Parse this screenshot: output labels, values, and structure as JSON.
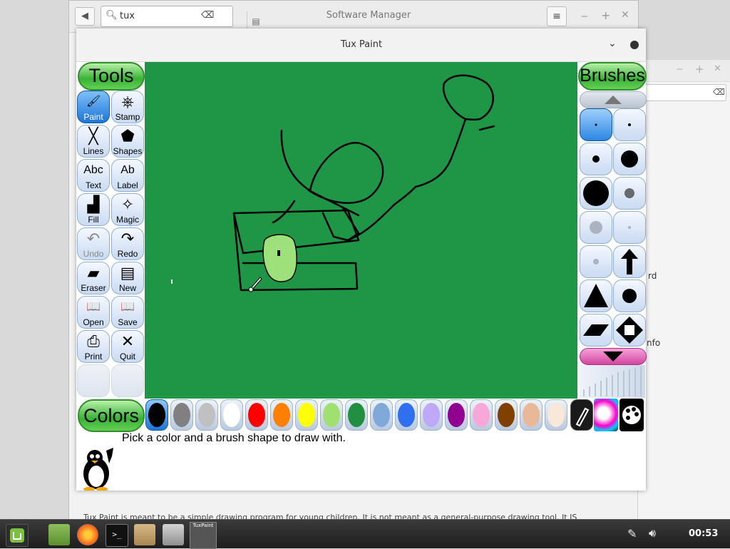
{
  "software_manager": {
    "title": "Software Manager",
    "search_value": "tux",
    "back_icon": "arrow-left-icon",
    "clear_icon": "clear-icon",
    "body_text": "Tux Paint is meant to be a simple drawing program for young children. It is not meant as a general-purpose drawing tool. It IS",
    "right_pane": {
      "word1": "rd",
      "word2": "nfo"
    }
  },
  "tuxpaint": {
    "window_title": "Tux Paint",
    "tools_title": "Tools",
    "brushes_title": "Brushes",
    "colors_title": "Colors",
    "tools": [
      {
        "label": "Paint",
        "icon": "paintbrush-icon",
        "glyph": "🖌",
        "state": "active"
      },
      {
        "label": "Stamp",
        "icon": "stamp-icon",
        "glyph": "⎈",
        "state": "normal"
      },
      {
        "label": "Lines",
        "icon": "lines-icon",
        "glyph": "╳",
        "state": "normal"
      },
      {
        "label": "Shapes",
        "icon": "pentagon-icon",
        "glyph": "⬟",
        "state": "normal"
      },
      {
        "label": "Text",
        "icon": "text-icon",
        "glyph": "Abc",
        "state": "normal"
      },
      {
        "label": "Label",
        "icon": "label-icon",
        "glyph": "Ab",
        "state": "normal"
      },
      {
        "label": "Fill",
        "icon": "bucket-icon",
        "glyph": "▟",
        "state": "normal"
      },
      {
        "label": "Magic",
        "icon": "magic-wand-icon",
        "glyph": "✧",
        "state": "normal"
      },
      {
        "label": "Undo",
        "icon": "undo-icon",
        "glyph": "↶",
        "state": "disabled"
      },
      {
        "label": "Redo",
        "icon": "redo-icon",
        "glyph": "↷",
        "state": "normal"
      },
      {
        "label": "Eraser",
        "icon": "eraser-icon",
        "glyph": "▰",
        "state": "normal"
      },
      {
        "label": "New",
        "icon": "new-document-icon",
        "glyph": "▤",
        "state": "normal"
      },
      {
        "label": "Open",
        "icon": "open-book-icon",
        "glyph": "📖",
        "state": "normal"
      },
      {
        "label": "Save",
        "icon": "save-book-icon",
        "glyph": "📖",
        "state": "normal"
      },
      {
        "label": "Print",
        "icon": "printer-icon",
        "glyph": "⎙",
        "state": "normal"
      },
      {
        "label": "Quit",
        "icon": "quit-x-icon",
        "glyph": "✕",
        "state": "normal"
      },
      {
        "label": "",
        "icon": "blank-slot",
        "glyph": "",
        "state": "blank"
      },
      {
        "label": "",
        "icon": "blank-slot",
        "glyph": "",
        "state": "blank"
      }
    ],
    "brushes": [
      {
        "shape": "dot",
        "size": 3,
        "active": true
      },
      {
        "shape": "dot",
        "size": 4
      },
      {
        "shape": "dot",
        "size": 10
      },
      {
        "shape": "dot",
        "size": 24
      },
      {
        "shape": "dot",
        "size": 36
      },
      {
        "shape": "fuzzy",
        "size": 14
      },
      {
        "shape": "grey-dot",
        "size": 18
      },
      {
        "shape": "grey-dot",
        "size": 4
      },
      {
        "shape": "grey-dot",
        "size": 8
      },
      {
        "shape": "arrow",
        "size": 36
      },
      {
        "shape": "triangle",
        "size": 34
      },
      {
        "shape": "dot",
        "size": 20
      },
      {
        "shape": "parallelogram",
        "size": 36
      },
      {
        "shape": "diamond",
        "size": 36
      }
    ],
    "colors": [
      {
        "name": "black",
        "hex": "#000000",
        "active": true
      },
      {
        "name": "dark-grey",
        "hex": "#808080"
      },
      {
        "name": "light-grey",
        "hex": "#c0c0c0"
      },
      {
        "name": "white",
        "hex": "#ffffff"
      },
      {
        "name": "red",
        "hex": "#ff0000"
      },
      {
        "name": "orange",
        "hex": "#ff8000"
      },
      {
        "name": "yellow",
        "hex": "#ffff00"
      },
      {
        "name": "light-green",
        "hex": "#a0e070"
      },
      {
        "name": "green",
        "hex": "#209040"
      },
      {
        "name": "steel-blue",
        "hex": "#80a8d8"
      },
      {
        "name": "blue",
        "hex": "#3070f0"
      },
      {
        "name": "lavender",
        "hex": "#c0a8f8"
      },
      {
        "name": "purple",
        "hex": "#900090"
      },
      {
        "name": "pink",
        "hex": "#f8a8d8"
      },
      {
        "name": "brown",
        "hex": "#804000"
      },
      {
        "name": "tan",
        "hex": "#e8b898"
      },
      {
        "name": "beige",
        "hex": "#f8e8d8"
      }
    ],
    "canvas_color": "#1f9645",
    "tip_text": "Pick a color and a brush shape to draw with."
  },
  "taskbar": {
    "apps": [
      {
        "name": "menu-icon"
      },
      {
        "name": "files-icon"
      },
      {
        "name": "firefox-icon"
      },
      {
        "name": "terminal-icon",
        "glyph": ">_"
      },
      {
        "name": "archive-icon"
      },
      {
        "name": "mixer-icon"
      },
      {
        "name": "tuxpaint-icon",
        "glyph": "TuxPaint"
      }
    ],
    "clock": "00:53"
  }
}
